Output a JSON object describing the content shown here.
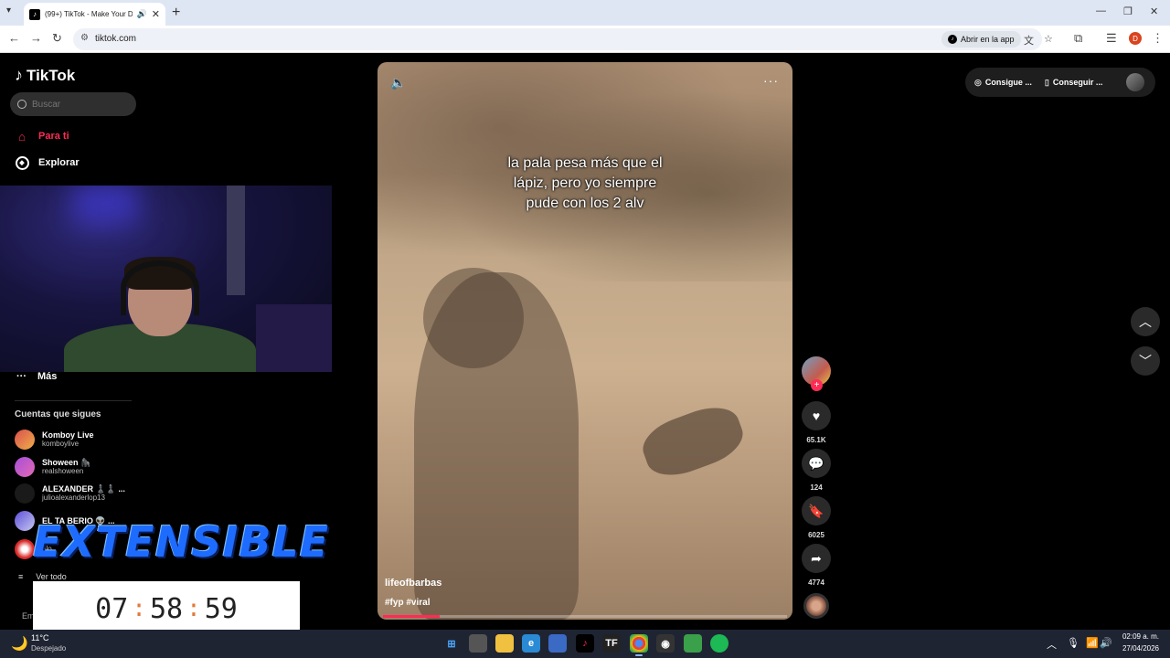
{
  "browser": {
    "tab_title": "(99+) TikTok - Make Your Day",
    "url": "tiktok.com",
    "open_app_label": "Abrir en la app",
    "profile_initial": "D"
  },
  "tiktok": {
    "logo_text": "TikTok",
    "search_placeholder": "Buscar",
    "nav": {
      "for_you": "Para ti",
      "explore": "Explorar",
      "more": "Más"
    },
    "following_title": "Cuentas que sigues",
    "accounts": [
      {
        "name": "Komboy Live",
        "handle": "komboylive"
      },
      {
        "name": "Shoween 🦍",
        "handle": "realshoween"
      },
      {
        "name": "ALEXANDER ♟️♟️ ...",
        "handle": "julioalexanderlop13"
      },
      {
        "name": "EL TA BERIO 👽 ...",
        "handle": ""
      },
      {
        "name": "",
        "handle": "olo"
      }
    ],
    "see_all": "Ver todo",
    "footer_partial": "Em",
    "top_right": {
      "get_coins": "Consigue ...",
      "get_app": "Conseguir ..."
    }
  },
  "overlay": {
    "brand": "EXTENSIBLE",
    "timer": {
      "h": "07",
      "m": "58",
      "s": "59"
    }
  },
  "video": {
    "caption_lines": [
      "la pala pesa más que el",
      "lápiz, pero yo siempre",
      "pude con los 2 alv"
    ],
    "username": "lifeofbarbas",
    "hashtags": "#fyp #viral",
    "progress_fraction": 0.14,
    "likes": "65.1K",
    "comments": "124",
    "saves": "6025",
    "shares": "4774",
    "accent_color": "#fe2c55"
  },
  "taskbar": {
    "temperature": "11°C",
    "weather": "Despejado",
    "time": "02:09 a. m.",
    "date": "27/04/2026"
  }
}
